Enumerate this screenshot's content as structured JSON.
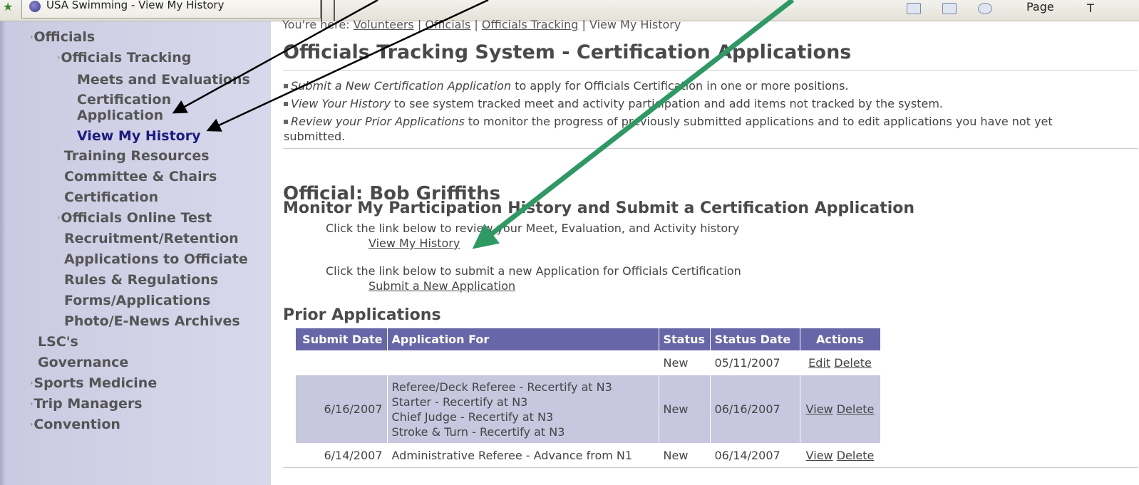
{
  "browser": {
    "tab_title": "USA Swimming - View My History",
    "page_menu": "Page",
    "tools_menu": "T"
  },
  "sidebar": {
    "items": [
      {
        "label": "Officials",
        "arrow": true
      },
      {
        "label": "Officials Tracking",
        "arrow": true
      },
      {
        "label": "Meets and Evaluations"
      },
      {
        "label": "Certification"
      },
      {
        "label": "Application"
      },
      {
        "label": "View My History",
        "current": true
      },
      {
        "label": "Training Resources"
      },
      {
        "label": "Committee & Chairs"
      },
      {
        "label": "Certification"
      },
      {
        "label": "Officials Online Test",
        "arrow": true
      },
      {
        "label": "Recruitment/Retention"
      },
      {
        "label": "Applications to Officiate"
      },
      {
        "label": "Rules & Regulations"
      },
      {
        "label": "Forms/Applications"
      },
      {
        "label": "Photo/E-News Archives"
      },
      {
        "label": "LSC's"
      },
      {
        "label": "Governance"
      },
      {
        "label": "Sports Medicine",
        "arrow": true
      },
      {
        "label": "Trip Managers",
        "arrow": true
      },
      {
        "label": "Convention",
        "arrow": true
      }
    ]
  },
  "breadcrumb": {
    "prefix": "You're here:",
    "items": [
      "Volunteers",
      "Officials",
      "Officials Tracking"
    ],
    "current": "View My History",
    "separator": "|"
  },
  "main": {
    "title": "Officials Tracking System - Certification Applications",
    "intro": [
      {
        "em": "Submit a New Certification Application",
        "rest": " to apply for Officials Certification in one or more positions."
      },
      {
        "em": "View Your History",
        "rest": " to see system tracked meet and activity participation and add items not tracked by the system."
      },
      {
        "em": "Review your Prior Applications",
        "rest": " to monitor the progress of previously submitted applications and to edit applications you have not yet"
      }
    ],
    "intro_wrap": "submitted.",
    "official": "Official: Bob Griffiths",
    "monitor_heading": "Monitor My Participation History and Submit a Certification Application",
    "history_text": "Click the link below to review your Meet, Evaluation, and Activity history",
    "history_link": "View My History",
    "submit_text": "Click the link below to submit a new Application for Officials Certification",
    "submit_link": "Submit a New Application",
    "prior_heading": "Prior Applications"
  },
  "table": {
    "headers": [
      "Submit Date",
      "Application For",
      "Status",
      "Status Date",
      "Actions"
    ],
    "rows": [
      {
        "submit_date": "",
        "application_for": [],
        "status": "New",
        "status_date": "05/11/2007",
        "actions": [
          "Edit",
          "Delete"
        ]
      },
      {
        "submit_date": "6/16/2007",
        "application_for": [
          "Referee/Deck Referee - Recertify at N3",
          "Starter - Recertify at N3",
          "Chief Judge - Recertify at N3",
          "Stroke & Turn - Recertify at N3"
        ],
        "status": "New",
        "status_date": "06/16/2007",
        "actions": [
          "View",
          "Delete"
        ]
      },
      {
        "submit_date": "6/14/2007",
        "application_for": [
          "Administrative Referee - Advance from N1"
        ],
        "status": "New",
        "status_date": "06/14/2007",
        "actions": [
          "View",
          "Delete"
        ]
      }
    ]
  },
  "annotations": {
    "arrow_black": "#000000",
    "arrow_green": "#2e9963"
  },
  "colors": {
    "sidebar_bg": "#c9c9e1",
    "nav_text": "#555555",
    "nav_current": "#1c1c80",
    "table_header": "#6666a8",
    "table_alt_row": "#c7c7df"
  }
}
